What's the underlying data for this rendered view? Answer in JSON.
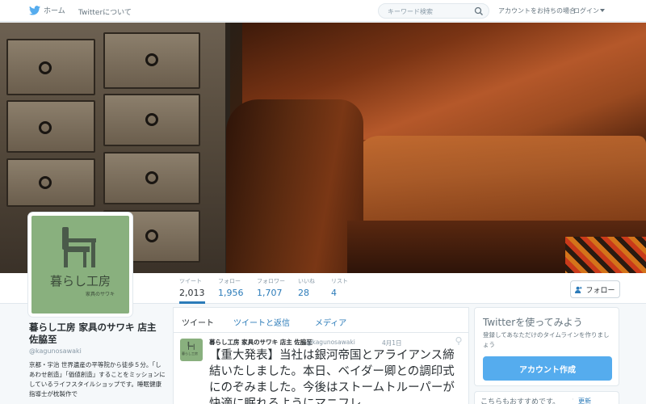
{
  "nav": {
    "home_label": "ホーム",
    "about_label": "Twitterについて",
    "search_placeholder": "キーワード検索",
    "have_account_text": "アカウントをお持ちの場合",
    "login_label": "ログイン"
  },
  "colors": {
    "accent": "#55acee",
    "link": "#2b7bb9",
    "avatar_bg": "#89b07e"
  },
  "stats": [
    {
      "label": "ツイート",
      "value": "2,013"
    },
    {
      "label": "フォロー",
      "value": "1,956"
    },
    {
      "label": "フォロワー",
      "value": "1,707"
    },
    {
      "label": "いいね",
      "value": "28"
    },
    {
      "label": "リスト",
      "value": "4"
    }
  ],
  "follow_button": "フォロー",
  "avatar": {
    "title": "暮らし工房",
    "subtitle": "家具のサワキ"
  },
  "profile": {
    "name": "暮らし工房 家具のサワキ 店主 佐脇至",
    "handle": "@kagunosawaki",
    "bio": "京都・宇治 世界遺産の平等院から徒歩５分。「しあわせ創造」「価値創造」することをミッションにしているライフスタイルショップです。睡眠健康指導士が枕製作で"
  },
  "tabs": [
    {
      "label": "ツイート"
    },
    {
      "label": "ツイートと返信"
    },
    {
      "label": "メディア"
    }
  ],
  "tweet": {
    "author": "暮らし工房 家具のサワキ 店主 佐脇至",
    "handle": "@kagunosawaki",
    "time": "4月1日",
    "text": "【重大発表】当社は銀河帝国とアライアンス締結いたしました。本日、ベイダー卿との調印式にのぞみました。今後はストームトルーパーが快適に眠れるようにマニフレ"
  },
  "signup": {
    "title": "Twitterを使ってみよう",
    "description": "登録してあなただけのタイムラインを作りましょう",
    "button": "アカウント作成"
  },
  "suggestions": {
    "title": "こちらもおすすめです。",
    "separator": "·",
    "refresh": "更新"
  }
}
